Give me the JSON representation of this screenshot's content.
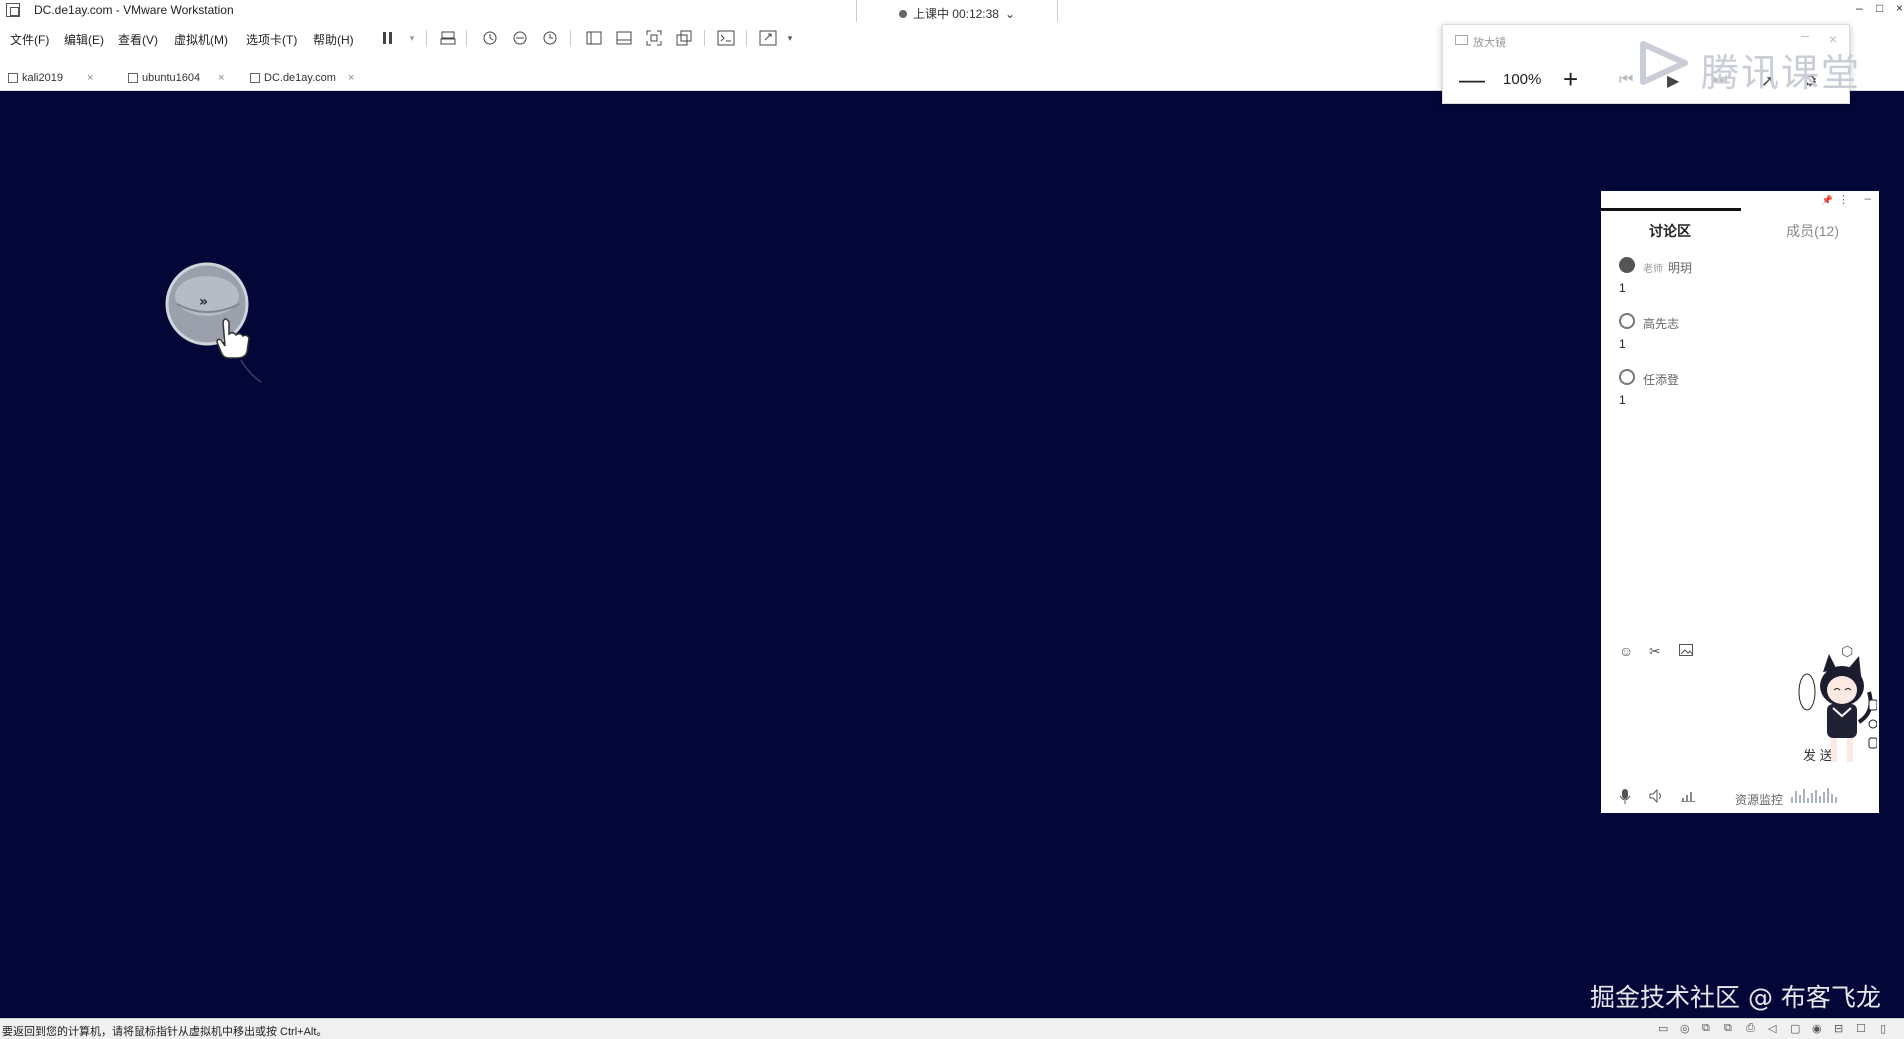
{
  "window": {
    "title": "DC.de1ay.com - VMware Workstation",
    "controls": {
      "minimize": "–",
      "maximize": "□",
      "close": "×"
    }
  },
  "session": {
    "status": "上课中 00:12:38",
    "chevron": "⌄"
  },
  "menubar": {
    "items": [
      "文件(F)",
      "编辑(E)",
      "查看(V)",
      "虚拟机(M)",
      "选项卡(T)",
      "帮助(H)"
    ]
  },
  "toolbar": {
    "icons": [
      "pause-icon",
      "dropdown-icon",
      "send-keys-icon",
      "snapshot-icon",
      "snapshot-restore-icon",
      "snapshot-manager-icon",
      "sidebar-icon",
      "thumbnail-icon",
      "fullscreen-icon",
      "unity-icon",
      "console-icon",
      "stretch-icon"
    ]
  },
  "vm_tabs": [
    {
      "label": "kali2019",
      "close": "×"
    },
    {
      "label": "ubuntu1604",
      "close": "×"
    },
    {
      "label": "DC.de1ay.com",
      "close": "×"
    }
  ],
  "magnifier": {
    "title": "放大镜",
    "zoom": "100%",
    "minus": "—",
    "plus": "+",
    "minimize": "–",
    "close": "×"
  },
  "brand_watermark": {
    "text": "腾讯课堂"
  },
  "chat": {
    "tabs": {
      "discussion": "讨论区",
      "members": "成员(12)"
    },
    "messages": [
      {
        "role": "老师",
        "sender": "明玥",
        "text": "1"
      },
      {
        "role": "",
        "sender": "高先志",
        "text": "1"
      },
      {
        "role": "",
        "sender": "任添登",
        "text": "1"
      }
    ],
    "tools": [
      "emoji-icon",
      "scissors-icon",
      "image-icon",
      "settings-icon"
    ],
    "send_label": "发 送",
    "bottom_tools": [
      "microphone-icon",
      "speaker-icon",
      "signal-icon"
    ],
    "resource_label": "资源监控"
  },
  "footer_watermark": "掘金技术社区 @ 布客飞龙",
  "statusbar": {
    "text": "要返回到您的计算机，请将鼠标指针从虚拟机中移出或按 Ctrl+Alt。"
  },
  "colors": {
    "vm_background": "#020738",
    "chrome_background": "#ffffff",
    "statusbar_background": "#f0f0f0"
  }
}
